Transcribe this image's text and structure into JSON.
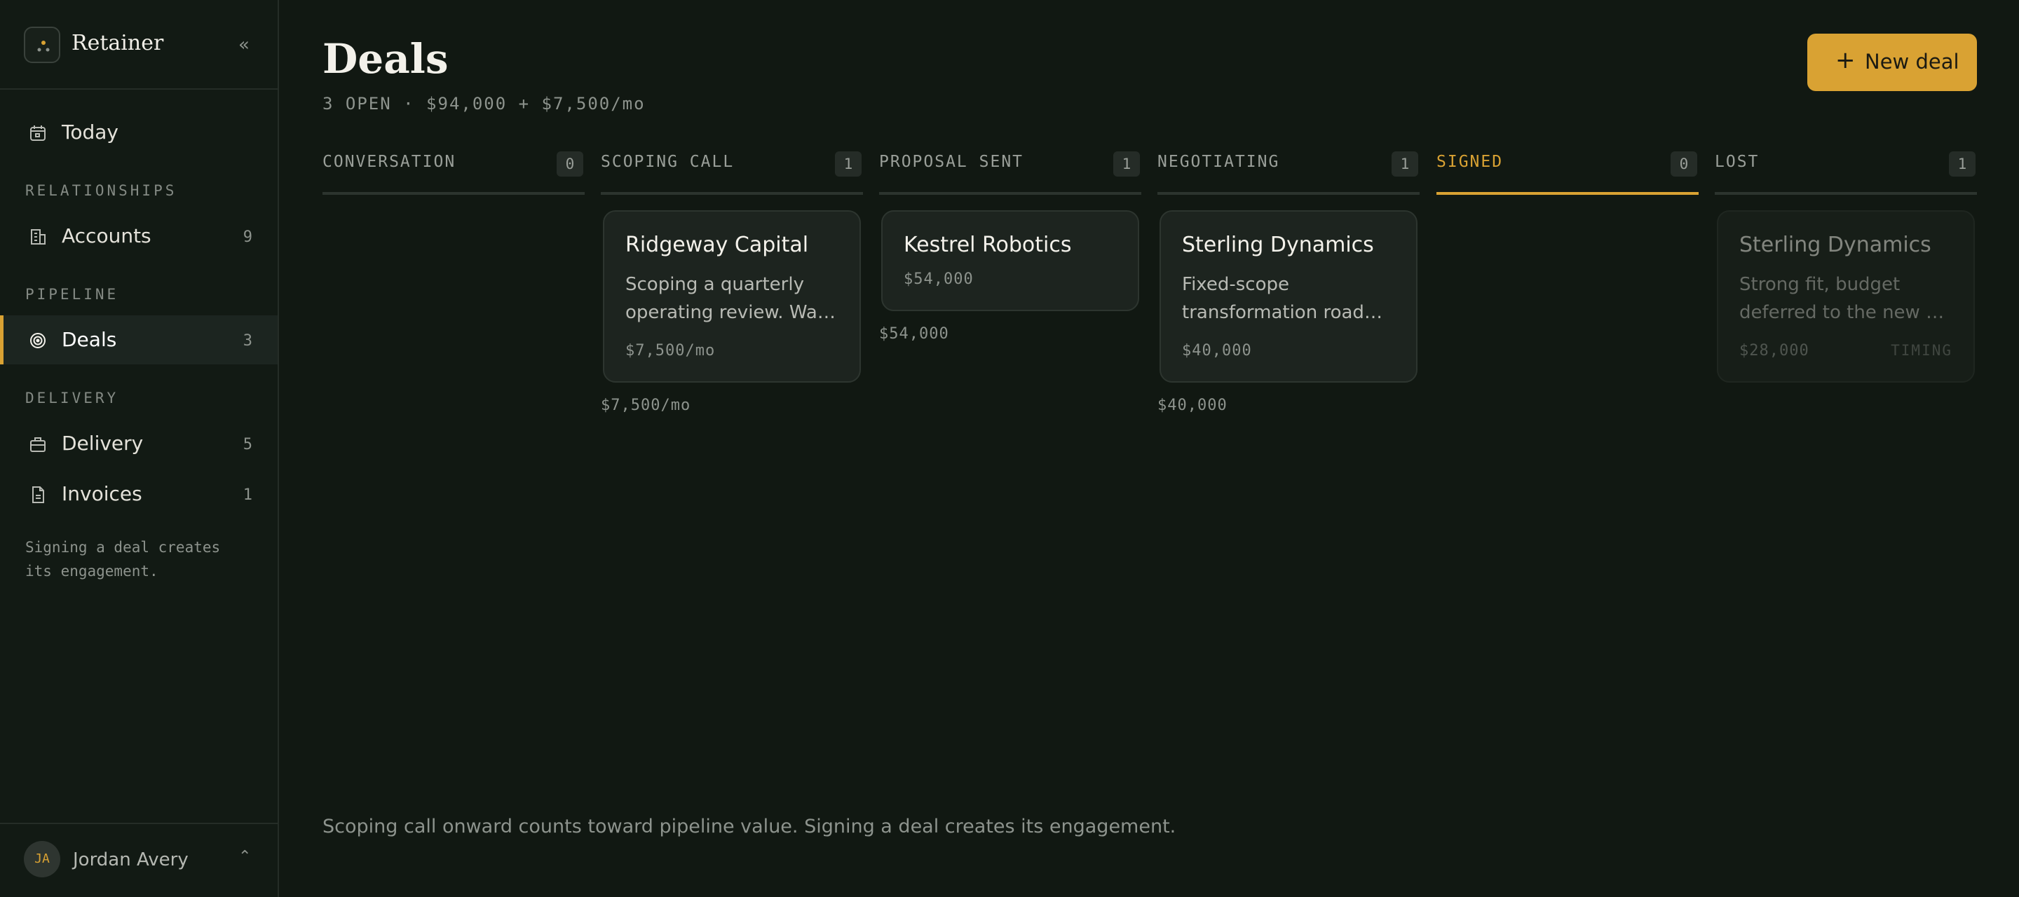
{
  "app": {
    "name": "Retainer",
    "collapse_icon": "«"
  },
  "sidebar": {
    "nav": [
      {
        "label": "Today",
        "icon": "calendar-icon"
      }
    ],
    "sections": [
      {
        "label": "RELATIONSHIPS",
        "items": [
          {
            "label": "Accounts",
            "count": "9",
            "icon": "building-icon"
          }
        ]
      },
      {
        "label": "PIPELINE",
        "items": [
          {
            "label": "Deals",
            "count": "3",
            "icon": "target-icon",
            "active": true
          }
        ]
      },
      {
        "label": "DELIVERY",
        "items": [
          {
            "label": "Delivery",
            "count": "5",
            "icon": "briefcase-icon"
          },
          {
            "label": "Invoices",
            "count": "1",
            "icon": "document-icon"
          }
        ]
      }
    ],
    "note_line1": "Signing a deal creates",
    "note_line2": "its engagement.",
    "user": {
      "initials": "JA",
      "name": "Jordan Avery",
      "chevron": "⌃"
    }
  },
  "page": {
    "title": "Deals",
    "summary": "3 OPEN · $94,000 + $7,500/mo",
    "new_deal_label": "New deal",
    "new_deal_icon": "+",
    "footer_note": "Scoping call onward counts toward pipeline value. Signing a deal creates its engagement."
  },
  "columns": [
    {
      "name": "CONVERSATION",
      "count": "0"
    },
    {
      "name": "SCOPING CALL",
      "count": "1",
      "total": "$7,500/mo",
      "card": {
        "title": "Ridgeway Capital",
        "desc1": "Scoping a quarterly",
        "desc2": "operating review. Warm…",
        "value": "$7,500/mo"
      }
    },
    {
      "name": "PROPOSAL SENT",
      "count": "1",
      "total": "$54,000",
      "card": {
        "title": "Kestrel Robotics",
        "value": "$54,000"
      }
    },
    {
      "name": "NEGOTIATING",
      "count": "1",
      "total": "$40,000",
      "card": {
        "title": "Sterling Dynamics",
        "desc1": "Fixed-scope",
        "desc2": "transformation roadmap.…",
        "value": "$40,000"
      }
    },
    {
      "name": "SIGNED",
      "count": "0"
    },
    {
      "name": "LOST",
      "count": "1",
      "card": {
        "title": "Sterling Dynamics",
        "desc1": "Strong fit, budget",
        "desc2": "deferred to the new fisca…",
        "value": "$28,000",
        "reason": "TIMING"
      }
    }
  ],
  "colors": {
    "accent": "#d9a233",
    "background": "#111812",
    "card": "#1d241f"
  }
}
